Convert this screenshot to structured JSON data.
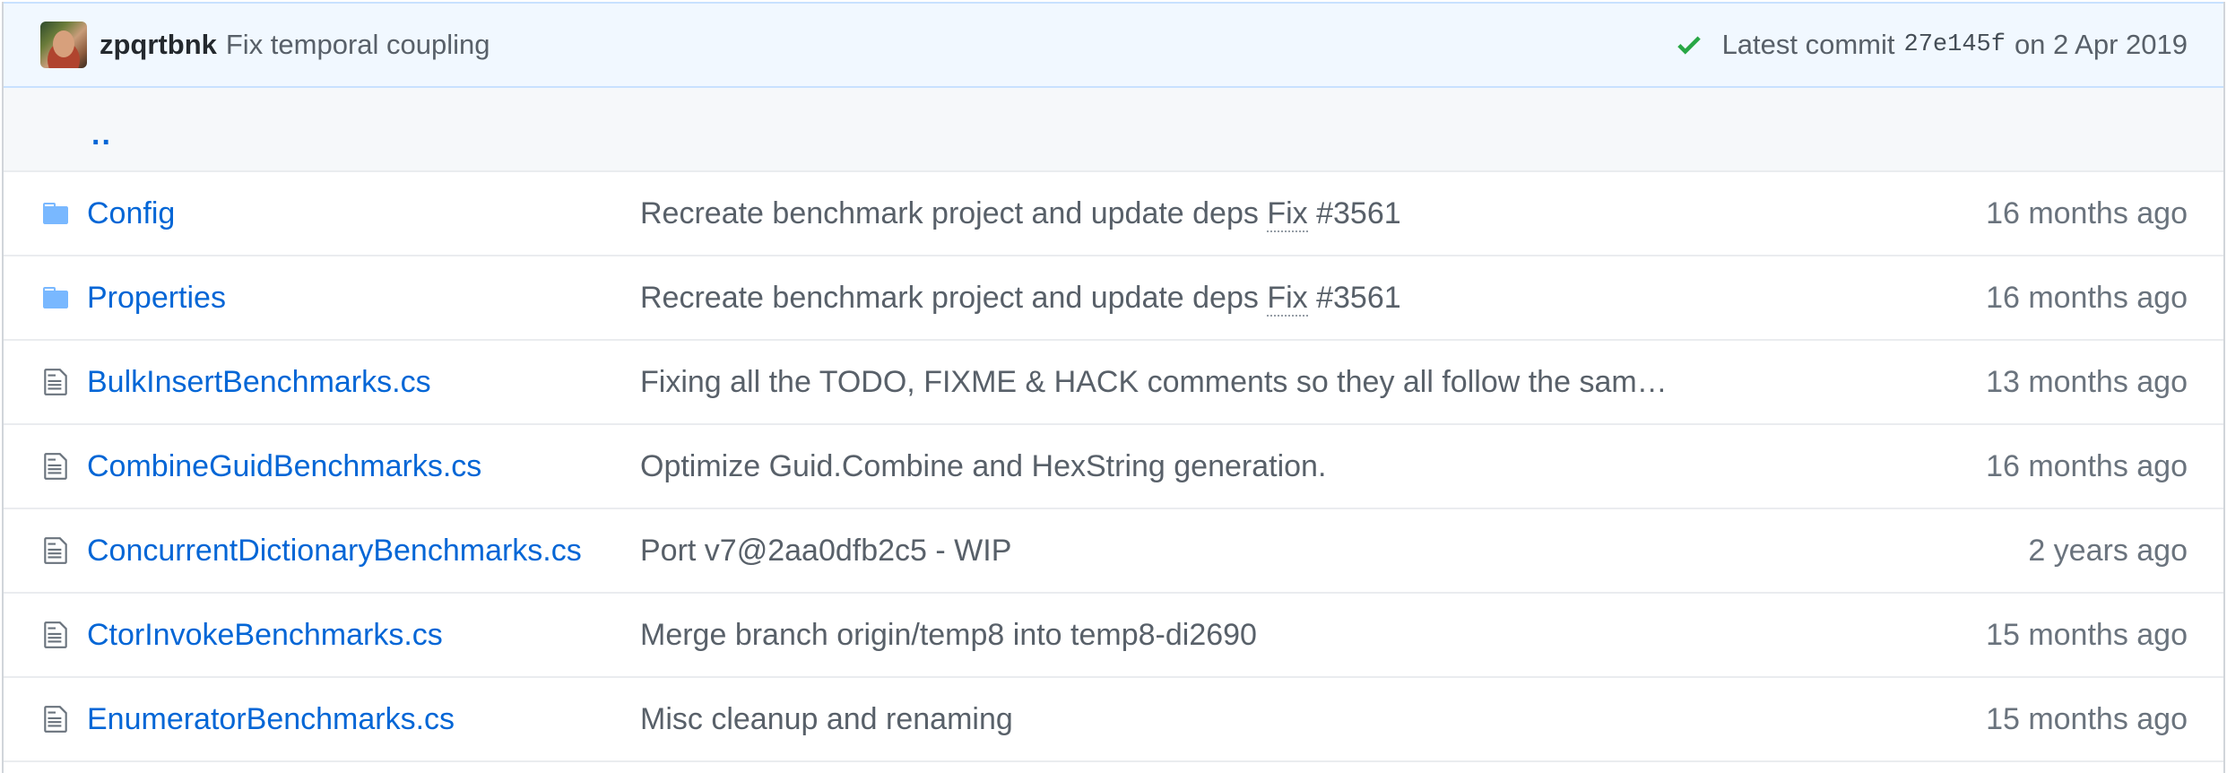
{
  "commit": {
    "author": "zpqrtbnk",
    "message": "Fix temporal coupling",
    "latest_label": "Latest commit",
    "sha": "27e145f",
    "date_text": "on 2 Apr 2019",
    "status_color": "#28a745"
  },
  "up_dir": {
    "label": ".."
  },
  "files": [
    {
      "name": "Config",
      "type": "folder",
      "icon": "folder-icon",
      "message_pre": "Recreate benchmark project and update deps ",
      "message_link": "Fix",
      "message_post": " #3561",
      "age": "16 months ago"
    },
    {
      "name": "Properties",
      "type": "folder",
      "icon": "folder-icon",
      "message_pre": "Recreate benchmark project and update deps ",
      "message_link": "Fix",
      "message_post": " #3561",
      "age": "16 months ago"
    },
    {
      "name": "BulkInsertBenchmarks.cs",
      "type": "file",
      "icon": "file-icon",
      "message_pre": "Fixing all the TODO, FIXME & HACK comments so they all follow the sam…",
      "message_link": "",
      "message_post": "",
      "age": "13 months ago"
    },
    {
      "name": "CombineGuidBenchmarks.cs",
      "type": "file",
      "icon": "file-icon",
      "message_pre": "Optimize Guid.Combine and HexString generation.",
      "message_link": "",
      "message_post": "",
      "age": "16 months ago"
    },
    {
      "name": "ConcurrentDictionaryBenchmarks.cs",
      "type": "file",
      "icon": "file-icon",
      "message_pre": "Port v7@2aa0dfb2c5 - WIP",
      "message_link": "",
      "message_post": "",
      "age": "2 years ago"
    },
    {
      "name": "CtorInvokeBenchmarks.cs",
      "type": "file",
      "icon": "file-icon",
      "message_pre": "Merge branch origin/temp8 into temp8-di2690",
      "message_link": "",
      "message_post": "",
      "age": "15 months ago"
    },
    {
      "name": "EnumeratorBenchmarks.cs",
      "type": "file",
      "icon": "file-icon",
      "message_pre": "Misc cleanup and renaming",
      "message_link": "",
      "message_post": "",
      "age": "15 months ago"
    }
  ],
  "colors": {
    "link": "#0366d6",
    "muted": "#586069",
    "folder": "#79b8ff",
    "commit_bg": "#f1f8ff"
  }
}
